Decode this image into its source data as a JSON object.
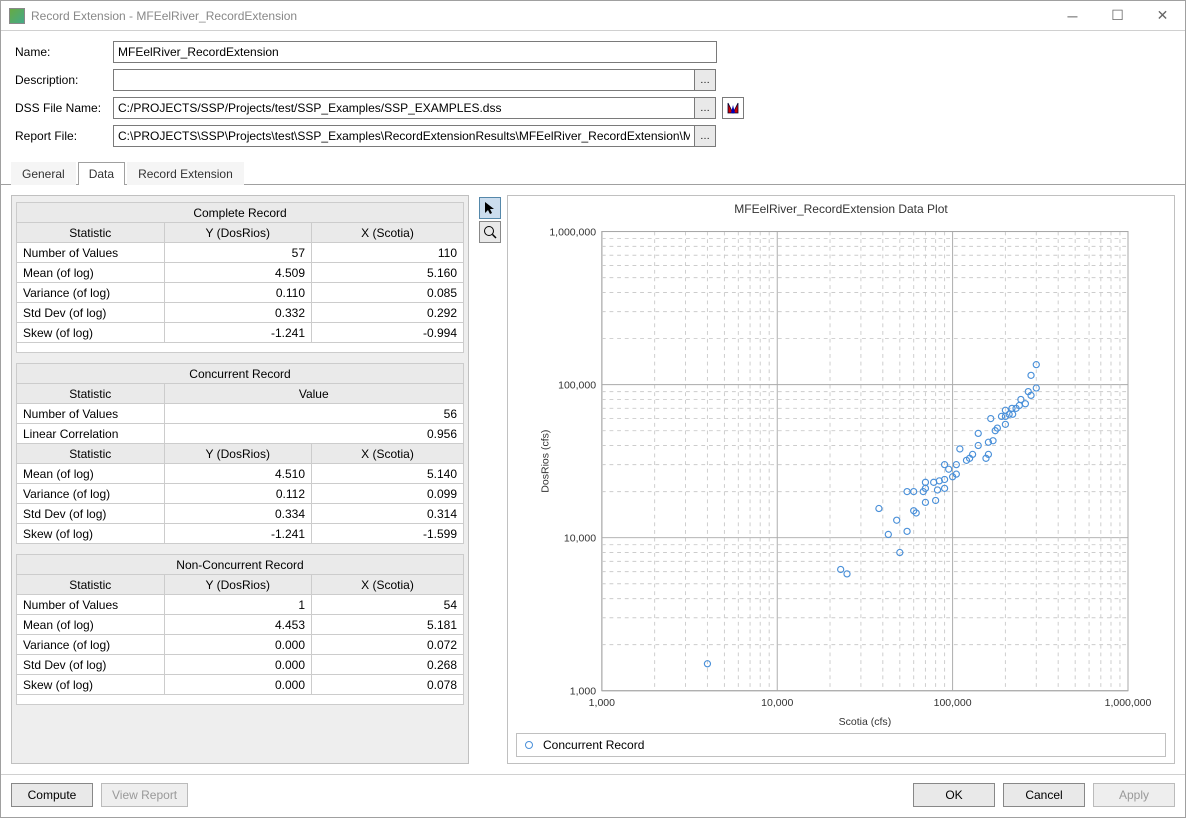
{
  "window": {
    "title": "Record Extension -  MFEelRiver_RecordExtension"
  },
  "form": {
    "name_label": "Name:",
    "name_value": "MFEelRiver_RecordExtension",
    "desc_label": "Description:",
    "desc_value": "",
    "dss_label": "DSS File Name:",
    "dss_value": "C:/PROJECTS/SSP/Projects/test/SSP_Examples/SSP_EXAMPLES.dss",
    "report_label": "Report File:",
    "report_value": "C:\\PROJECTS\\SSP\\Projects\\test\\SSP_Examples\\RecordExtensionResults\\MFEelRiver_RecordExtension\\M"
  },
  "tabs": {
    "general": "General",
    "data": "Data",
    "record_extension": "Record Extension"
  },
  "tables": {
    "complete": {
      "title": "Complete Record",
      "headers": {
        "stat": "Statistic",
        "y": "Y (DosRios)",
        "x": "X (Scotia)"
      },
      "rows": [
        {
          "label": "Number of Values",
          "y": "57",
          "x": "110"
        },
        {
          "label": "Mean (of log)",
          "y": "4.509",
          "x": "5.160"
        },
        {
          "label": "Variance (of log)",
          "y": "0.110",
          "x": "0.085"
        },
        {
          "label": "Std Dev (of log)",
          "y": "0.332",
          "x": "0.292"
        },
        {
          "label": "Skew (of log)",
          "y": "-1.241",
          "x": "-0.994"
        }
      ]
    },
    "concurrent": {
      "title": "Concurrent Record",
      "headers": {
        "stat": "Statistic",
        "value": "Value",
        "y": "Y (DosRios)",
        "x": "X (Scotia)"
      },
      "top_rows": [
        {
          "label": "Number of Values",
          "value": "56"
        },
        {
          "label": "Linear Correlation",
          "value": "0.956"
        }
      ],
      "rows": [
        {
          "label": "Mean (of log)",
          "y": "4.510",
          "x": "5.140"
        },
        {
          "label": "Variance (of log)",
          "y": "0.112",
          "x": "0.099"
        },
        {
          "label": "Std Dev (of log)",
          "y": "0.334",
          "x": "0.314"
        },
        {
          "label": "Skew (of log)",
          "y": "-1.241",
          "x": "-1.599"
        }
      ]
    },
    "nonconcurrent": {
      "title": "Non-Concurrent Record",
      "headers": {
        "stat": "Statistic",
        "y": "Y (DosRios)",
        "x": "X (Scotia)"
      },
      "rows": [
        {
          "label": "Number of Values",
          "y": "1",
          "x": "54"
        },
        {
          "label": "Mean (of log)",
          "y": "4.453",
          "x": "5.181"
        },
        {
          "label": "Variance (of log)",
          "y": "0.000",
          "x": "0.072"
        },
        {
          "label": "Std Dev (of log)",
          "y": "0.000",
          "x": "0.268"
        },
        {
          "label": "Skew (of log)",
          "y": "0.000",
          "x": "0.078"
        }
      ]
    }
  },
  "plot": {
    "title": "MFEelRiver_RecordExtension Data Plot",
    "xlabel": "Scotia (cfs)",
    "ylabel": "DosRios (cfs)",
    "legend": "Concurrent Record",
    "ticks": {
      "t1000": "1,000",
      "t10000": "10,000",
      "t100000": "100,000",
      "t1000000": "1,000,000"
    }
  },
  "buttons": {
    "compute": "Compute",
    "view_report": "View Report",
    "ok": "OK",
    "cancel": "Cancel",
    "apply": "Apply"
  },
  "chart_data": {
    "type": "scatter",
    "title": "MFEelRiver_RecordExtension Data Plot",
    "xlabel": "Scotia (cfs)",
    "ylabel": "DosRios (cfs)",
    "xscale": "log",
    "yscale": "log",
    "xlim": [
      1000,
      1000000
    ],
    "ylim": [
      1000,
      1000000
    ],
    "series": [
      {
        "name": "Concurrent Record",
        "points": [
          [
            4000,
            1500
          ],
          [
            25000,
            5800
          ],
          [
            23000,
            6200
          ],
          [
            50000,
            8000
          ],
          [
            43000,
            10500
          ],
          [
            55000,
            11000
          ],
          [
            48000,
            13000
          ],
          [
            62000,
            14500
          ],
          [
            38000,
            15500
          ],
          [
            60000,
            15000
          ],
          [
            70000,
            17000
          ],
          [
            80000,
            17500
          ],
          [
            55000,
            20000
          ],
          [
            60000,
            20000
          ],
          [
            68000,
            20000
          ],
          [
            70000,
            21000
          ],
          [
            82000,
            20500
          ],
          [
            90000,
            21000
          ],
          [
            70000,
            23000
          ],
          [
            78000,
            23000
          ],
          [
            84000,
            23500
          ],
          [
            90000,
            24000
          ],
          [
            100000,
            25000
          ],
          [
            105000,
            26000
          ],
          [
            95000,
            28000
          ],
          [
            90000,
            30000
          ],
          [
            105000,
            30000
          ],
          [
            120000,
            32000
          ],
          [
            125000,
            33000
          ],
          [
            130000,
            35000
          ],
          [
            155000,
            33000
          ],
          [
            160000,
            35000
          ],
          [
            110000,
            38000
          ],
          [
            140000,
            40000
          ],
          [
            160000,
            42000
          ],
          [
            170000,
            43000
          ],
          [
            140000,
            48000
          ],
          [
            175000,
            50000
          ],
          [
            180000,
            52000
          ],
          [
            200000,
            55000
          ],
          [
            165000,
            60000
          ],
          [
            190000,
            62000
          ],
          [
            200000,
            62000
          ],
          [
            210000,
            64000
          ],
          [
            220000,
            64000
          ],
          [
            200000,
            68000
          ],
          [
            218000,
            70000
          ],
          [
            230000,
            70000
          ],
          [
            240000,
            73000
          ],
          [
            260000,
            75000
          ],
          [
            245000,
            80000
          ],
          [
            280000,
            85000
          ],
          [
            270000,
            90000
          ],
          [
            300000,
            95000
          ],
          [
            280000,
            115000
          ],
          [
            300000,
            135000
          ]
        ]
      }
    ]
  }
}
